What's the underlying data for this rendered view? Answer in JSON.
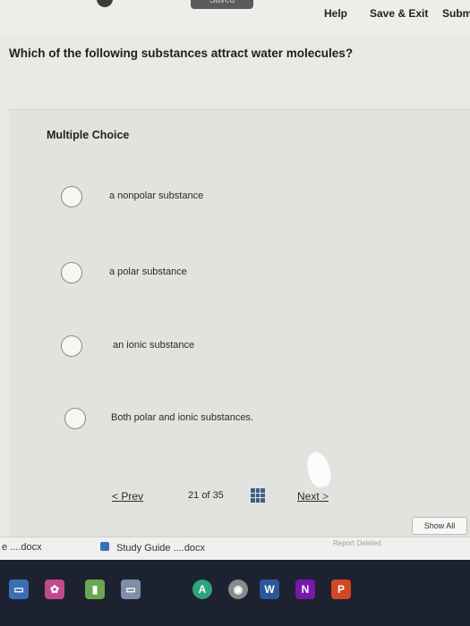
{
  "topbar": {
    "saved_label": "Saved",
    "help_label": "Help",
    "save_exit_label": "Save & Exit",
    "submit_label": "Subm"
  },
  "question": {
    "text": "Which of the following substances attract water molecules?"
  },
  "panel": {
    "type_label": "Multiple Choice",
    "options": [
      {
        "label": "a nonpolar substance"
      },
      {
        "label": "a polar substance"
      },
      {
        "label": "an ionic substance"
      },
      {
        "label": "Both polar and ionic substances."
      }
    ]
  },
  "nav": {
    "prev_label": "Prev",
    "prev_icon": "chevron-left-icon",
    "page_current": "21",
    "page_of": "of",
    "page_total": "35",
    "grid_icon": "grid-icon",
    "next_label": "Next",
    "next_icon": "chevron-right-icon"
  },
  "downloads": {
    "items": [
      {
        "label": "e ....docx"
      },
      {
        "label": "Study Guide ....docx"
      }
    ],
    "show_all_label": "Show All",
    "report_label": "Report Deleted"
  },
  "taskbar": {
    "icons": [
      {
        "name": "windows-store-icon",
        "glyph": "▭",
        "color": "#3b6fb5"
      },
      {
        "name": "photos-icon",
        "glyph": "✿",
        "color": "#c04a8a"
      },
      {
        "name": "chart-app-icon",
        "glyph": "▮",
        "color": "#6aa84f"
      },
      {
        "name": "screen-app-icon",
        "glyph": "▭",
        "color": "#7d8fa8"
      },
      {
        "name": "maps-icon",
        "glyph": "A",
        "color": "#2fa37a"
      },
      {
        "name": "chrome-icon",
        "glyph": "◉",
        "color": "#8a8a8a"
      },
      {
        "name": "word-icon",
        "glyph": "W",
        "color": "#2b579a"
      },
      {
        "name": "onenote-icon",
        "glyph": "N",
        "color": "#7719aa"
      },
      {
        "name": "powerpoint-icon",
        "glyph": "P",
        "color": "#d24726"
      }
    ]
  }
}
